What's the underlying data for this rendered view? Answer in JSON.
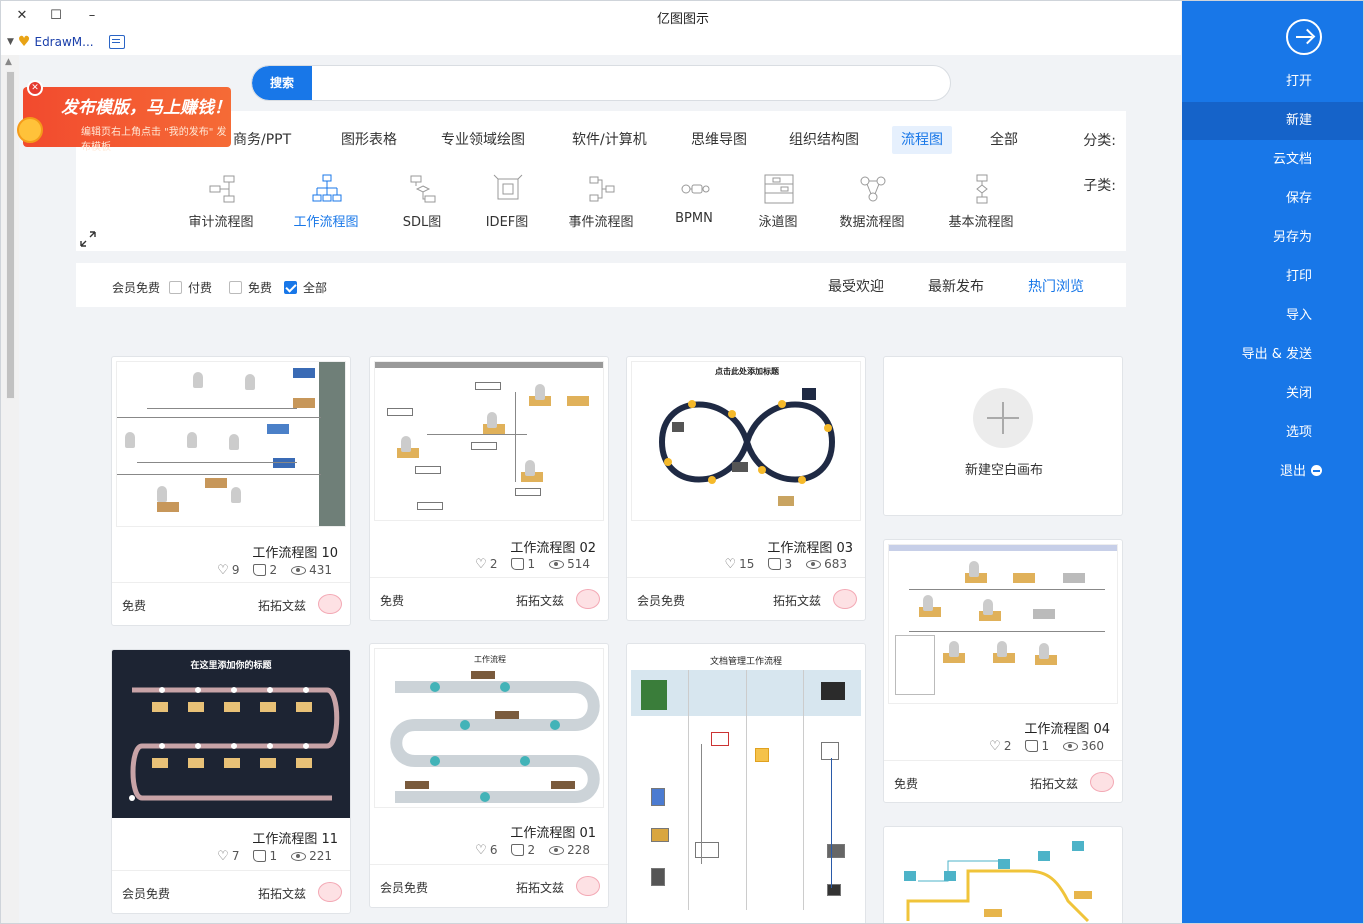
{
  "window": {
    "title": "亿图图示",
    "close": "✕",
    "maximize": "☐",
    "minimize": "–"
  },
  "menubar": {
    "brand": "EdrawM..."
  },
  "sidebar": {
    "items": [
      {
        "label": "打开"
      },
      {
        "label": "新建"
      },
      {
        "label": "云文档"
      },
      {
        "label": "保存"
      },
      {
        "label": "另存为"
      },
      {
        "label": "打印"
      },
      {
        "label": "导入"
      },
      {
        "label": "导出 & 发送"
      },
      {
        "label": "关闭"
      },
      {
        "label": "选项"
      },
      {
        "label": "退出"
      }
    ],
    "active_index": 1
  },
  "search": {
    "button": "搜索",
    "placeholder": ""
  },
  "ad": {
    "title": "发布模版，马上赚钱！",
    "subtitle": "编辑页右上角点击 \"我的发布\" 发布模板",
    "close": "✕"
  },
  "categories": {
    "label": "分类:",
    "items": [
      "全部",
      "流程图",
      "组织结构图",
      "思维导图",
      "软件/计算机",
      "专业领域绘图",
      "图形表格",
      "商务/PPT"
    ],
    "active": "流程图"
  },
  "subcategories": {
    "label": "子类:",
    "items": [
      "基本流程图",
      "数据流程图",
      "泳道图",
      "BPMN",
      "事件流程图",
      "IDEF图",
      "SDL图",
      "工作流程图",
      "审计流程图"
    ],
    "active": "工作流程图"
  },
  "sort": {
    "tabs": [
      "热门浏览",
      "最新发布",
      "最受欢迎"
    ],
    "active": "热门浏览",
    "filters": [
      {
        "label": "全部",
        "checked": true
      },
      {
        "label": "免费",
        "checked": false
      },
      {
        "label": "付费",
        "checked": false
      },
      {
        "label": "会员免费",
        "checked": false
      }
    ]
  },
  "new_blank": {
    "label": "新建空白画布"
  },
  "cards": [
    {
      "title": "工作流程图 10",
      "views": "431",
      "likes": "2",
      "favs": "9",
      "author": "拓拓文兹",
      "price": "免费"
    },
    {
      "title": "工作流程图 02",
      "views": "514",
      "likes": "1",
      "favs": "2",
      "author": "拓拓文兹",
      "price": "免费"
    },
    {
      "title": "工作流程图 03",
      "views": "683",
      "likes": "3",
      "favs": "15",
      "author": "拓拓文兹",
      "price": "会员免费"
    },
    {
      "title": "工作流程图 04",
      "views": "360",
      "likes": "1",
      "favs": "2",
      "author": "拓拓文兹",
      "price": "免费"
    },
    {
      "title": "工作流程图 11",
      "views": "221",
      "likes": "1",
      "favs": "7",
      "author": "拓拓文兹",
      "price": "会员免费"
    },
    {
      "title": "工作流程图 01",
      "views": "228",
      "likes": "2",
      "favs": "6",
      "author": "拓拓文兹",
      "price": "会员免费"
    }
  ],
  "thumb_texts": {
    "c11_heading": "在这里添加你的标题",
    "c01_heading": "工作流程",
    "c03_heading": "点击此处添加标题",
    "c05_heading": "文档管理工作流程"
  },
  "colors": {
    "accent": "#1877e8",
    "sidebar": "#1877e8",
    "sidebar_active": "#1563c9",
    "ad": "#f24a2e"
  }
}
